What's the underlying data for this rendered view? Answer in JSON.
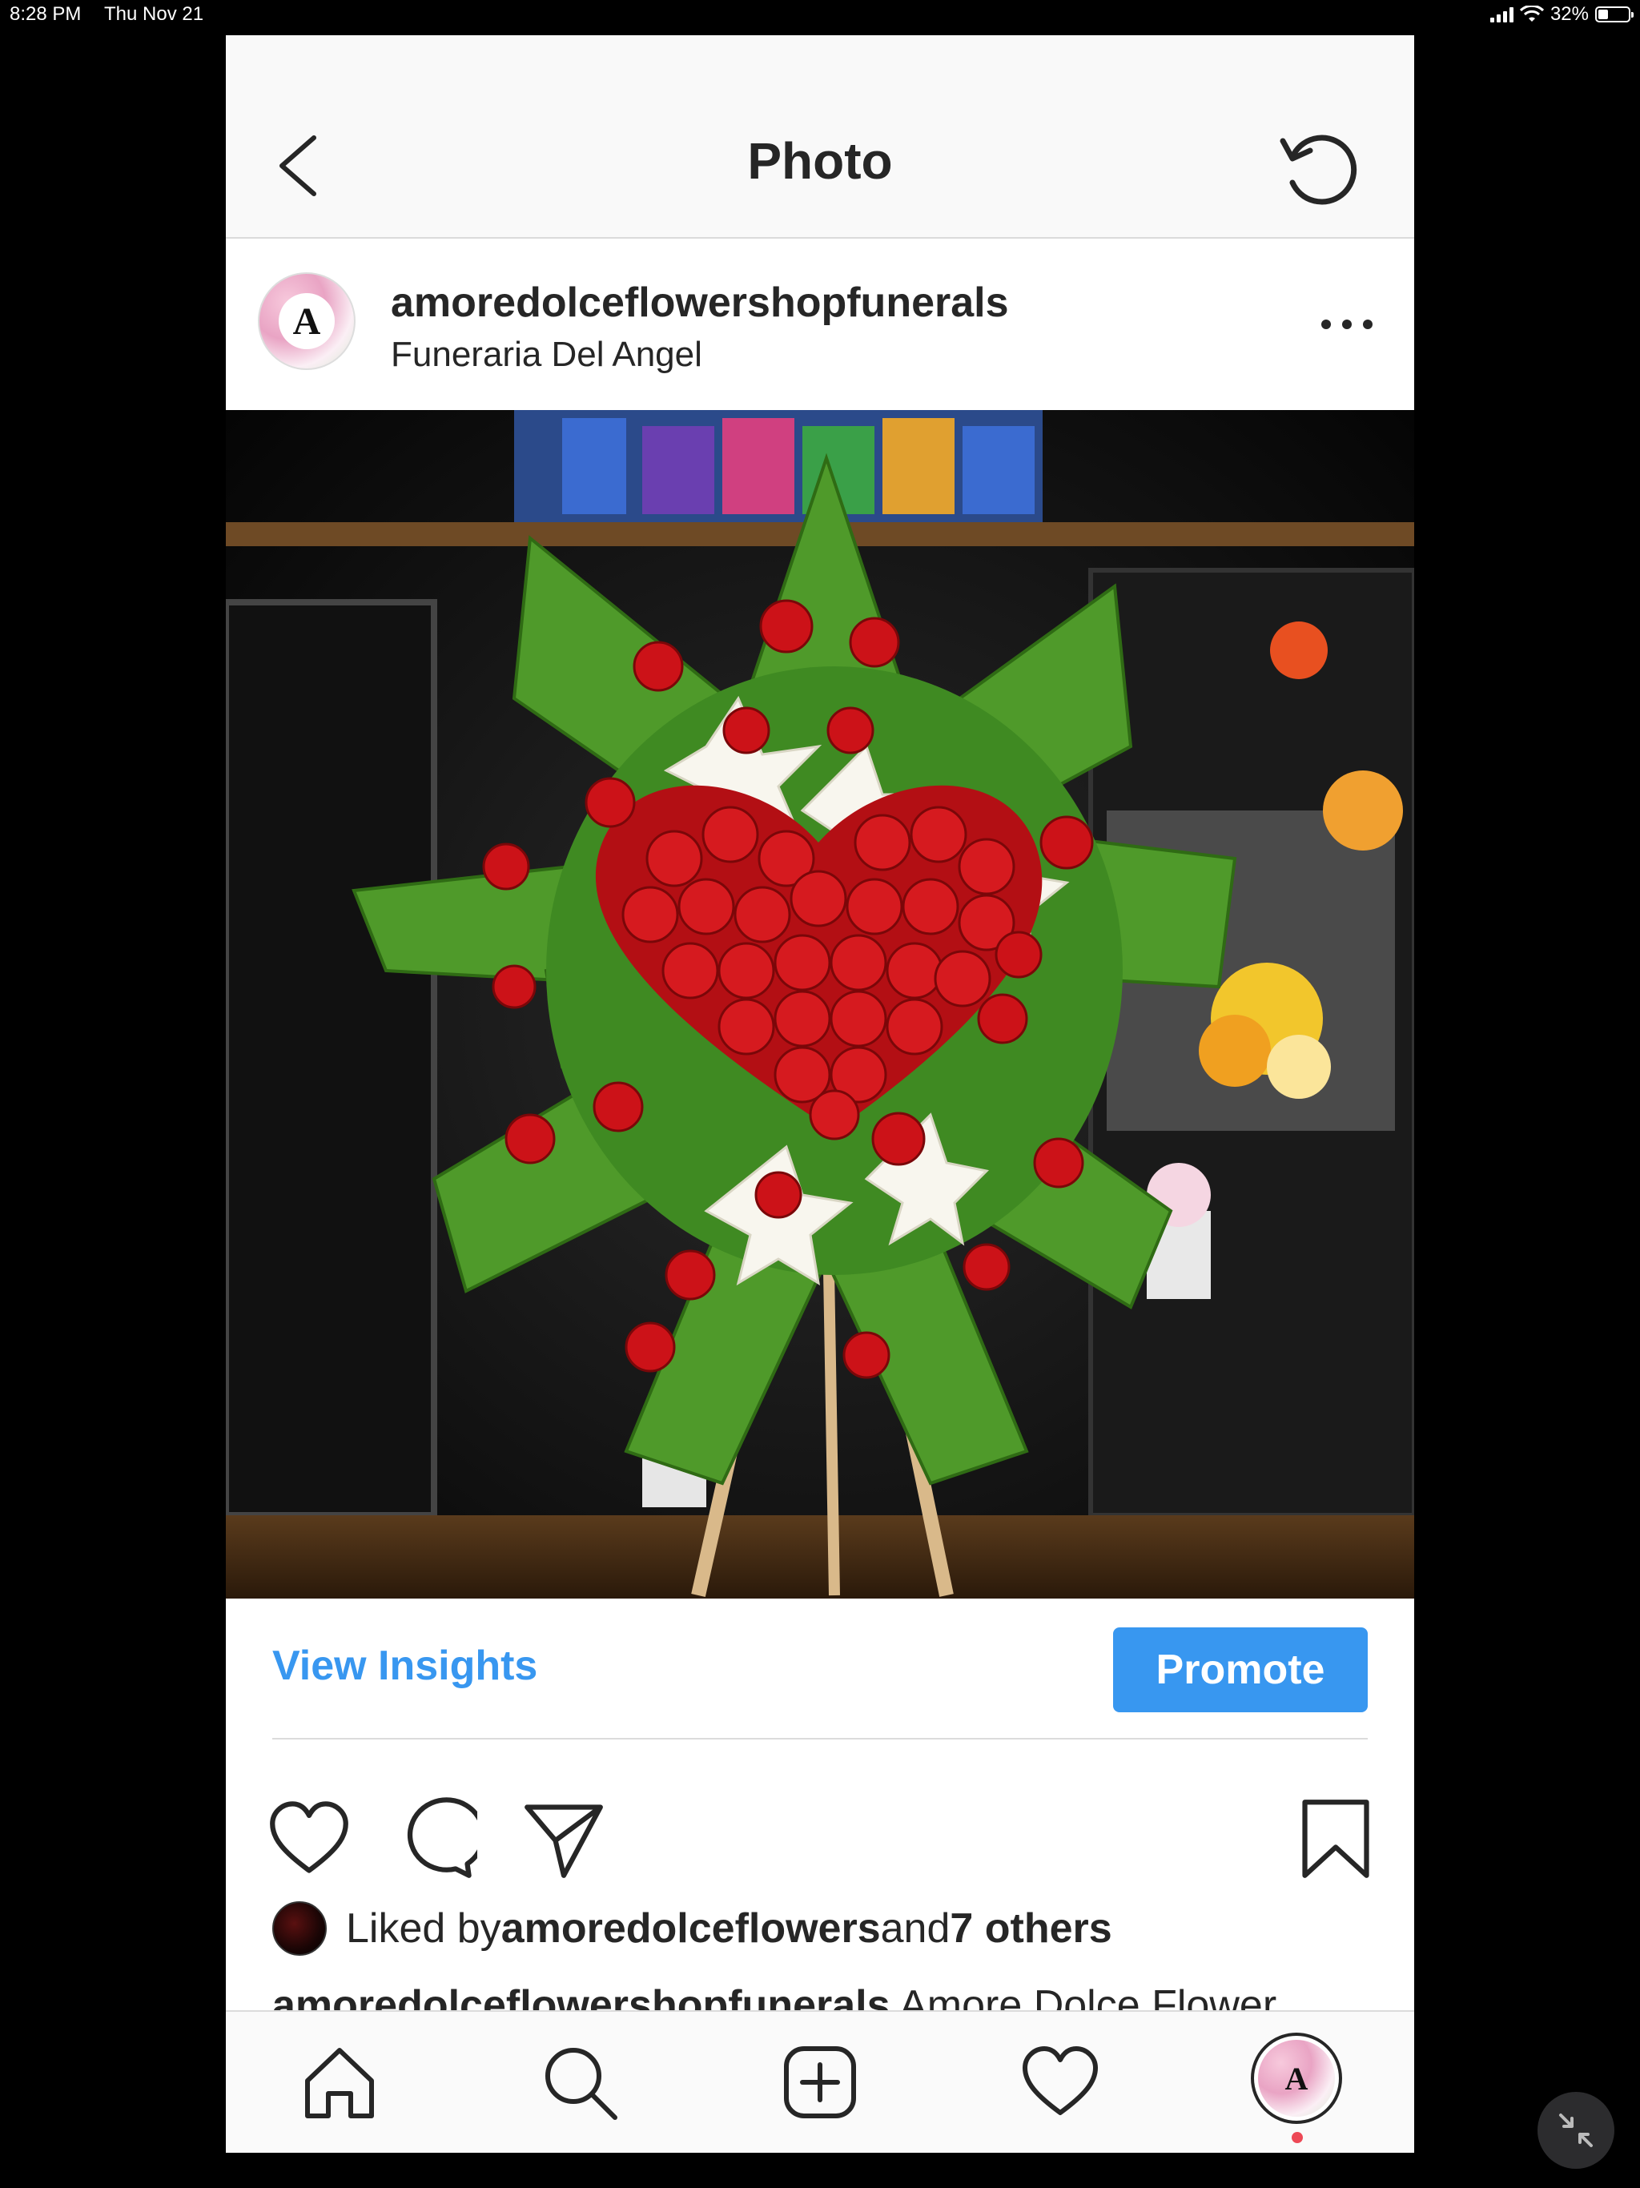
{
  "status_bar": {
    "time": "8:28 PM",
    "date": "Thu Nov 21",
    "battery": "32%",
    "battery_level": 0.32
  },
  "nav": {
    "title": "Photo"
  },
  "post": {
    "username": "amoredolceflowershopfunerals",
    "location": "Funeraria Del Angel",
    "avatar_letter": "A"
  },
  "insights": {
    "view_label": "View Insights",
    "promote_label": "Promote"
  },
  "likes": {
    "prefix": "Liked by ",
    "user": "amoredolceflowers",
    "middle": " and ",
    "others": "7 others"
  },
  "caption": {
    "username": "amoredolceflowershopfunerals",
    "text": " Amore Dolce Flower"
  },
  "icons": {
    "back": "chevron-left-icon",
    "refresh": "refresh-icon",
    "more": "more-icon",
    "like": "heart-icon",
    "comment": "comment-icon",
    "share": "send-icon",
    "save": "bookmark-icon",
    "home": "home-icon",
    "search": "search-icon",
    "add": "add-post-icon",
    "activity": "heart-icon",
    "profile": "profile-avatar"
  },
  "colors": {
    "accent": "#3897f0",
    "notification": "#ed4956",
    "text": "#262626"
  }
}
